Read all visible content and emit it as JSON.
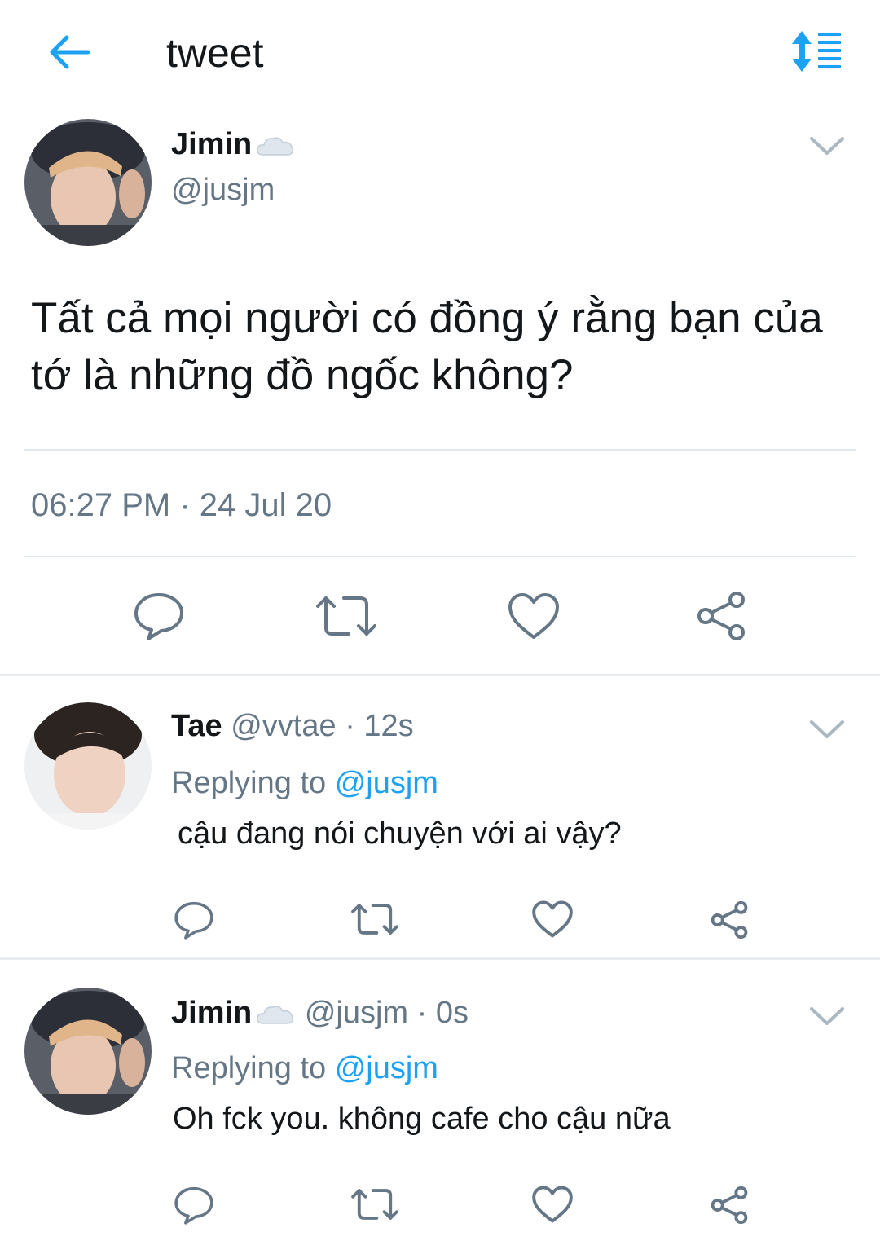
{
  "header": {
    "title": "tweet",
    "back_icon": "arrow-left-icon",
    "sort_icon": "sort-list-icon"
  },
  "colors": {
    "accent": "#1da1f2",
    "muted": "#657786",
    "text": "#14171a",
    "divider": "#e1e8ed"
  },
  "main_tweet": {
    "display_name": "Jimin",
    "handle": "@jusjm",
    "text": "Tất cả mọi người có đồng ý rằng bạn của tớ là những đồ ngốc không?",
    "timestamp": "06:27 PM · 24 Jul 20"
  },
  "replies": [
    {
      "display_name": "Tae",
      "handle": "@vvtae",
      "time": "· 12s",
      "replying_prefix": "Replying to",
      "replying_handle": "@jusjm",
      "text": "cậu đang nói chuyện với ai vậy?"
    },
    {
      "display_name": "Jimin",
      "handle": "@jusjm",
      "time": "· 0s",
      "replying_prefix": "Replying to",
      "replying_handle": "@jusjm",
      "text": "Oh fck you. không cafe cho cậu nữa"
    }
  ],
  "actions": [
    "reply-icon",
    "retweet-icon",
    "like-icon",
    "share-icon"
  ]
}
